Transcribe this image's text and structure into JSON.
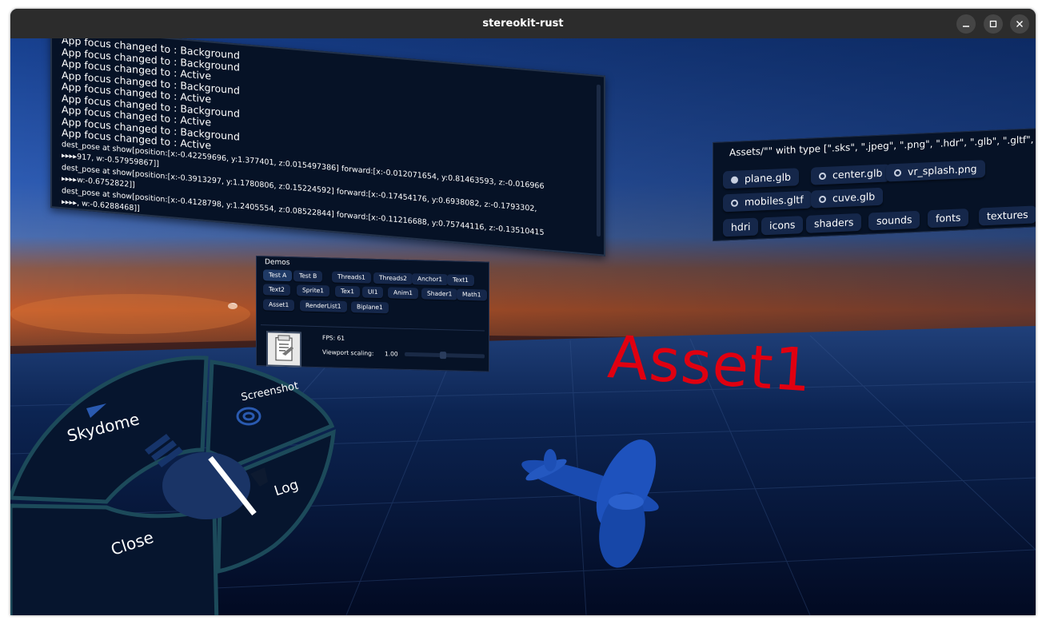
{
  "window": {
    "title": "stereokit-rust",
    "controls": [
      "minimize",
      "maximize",
      "close"
    ]
  },
  "log_panel": {
    "lines": [
      "App focus changed to : Background",
      "App focus changed to : Background",
      "App focus changed to : Active",
      "App focus changed to : Background",
      "App focus changed to : Active",
      "App focus changed to : Background",
      "App focus changed to : Active",
      "App focus changed to : Background",
      "App focus changed to : Active",
      "dest_pose at show[position:[x:-0.42259696, y:1.377401, z:0.015497386] forward:[x:-0.012071654, y:0.81463593, z:-0.016966",
      "▸▸▸▸917, w:-0.57959867]]",
      "dest_pose at show[position:[x:-0.3913297, y:1.1780806, z:0.15224592] forward:[x:-0.17454176, y:0.6938082, z:-0.1793302,",
      "▸▸▸▸w:-0.6752822]]",
      "dest_pose at show[position:[x:-0.4128798, y:1.2405554, z:0.08522844] forward:[x:-0.11216688, y:0.75744116, z:-0.13510415",
      "▸▸▸▸, w:-0.6288468]]"
    ]
  },
  "assets_panel": {
    "title": "Assets/\"\" with type [\".sks\", \".jpeg\", \".png\", \".hdr\", \".glb\", \".gltf\",",
    "files": [
      {
        "label": "plane.glb",
        "selected": true
      },
      {
        "label": "center.glb",
        "selected": false
      },
      {
        "label": "vr_splash.png",
        "selected": false
      },
      {
        "label": "mobiles.gltf",
        "selected": false
      },
      {
        "label": "cuve.glb",
        "selected": false
      }
    ],
    "folders": [
      "hdri",
      "icons",
      "shaders",
      "sounds",
      "fonts",
      "textures"
    ]
  },
  "demos_panel": {
    "title": "Demos",
    "rows": [
      [
        "Test A",
        "Test B",
        "Threads1",
        "Threads2",
        "Anchor1",
        "Text1"
      ],
      [
        "Text2",
        "Sprite1",
        "Tex1",
        "UI1",
        "Anim1",
        "Shader1",
        "Math1"
      ],
      [
        "Asset1",
        "RenderList1",
        "Biplane1"
      ]
    ],
    "fps_label": "FPS: 61",
    "viewport_label": "Viewport scaling:",
    "viewport_value": "1.00",
    "viewport_scaling": 1.0
  },
  "scene": {
    "asset_label": "Asset1",
    "asset_label_color": "#e00010",
    "model": "plane"
  },
  "radial_menu": {
    "items": [
      "Skydome",
      "Screenshot",
      "Log",
      "Close"
    ],
    "icons": [
      "skydome-icon",
      "screenshot-icon",
      "log-icon"
    ]
  },
  "colors": {
    "titlebar": "#2c2c2c",
    "panel": "#061226",
    "button": "#15274a",
    "floor": "#0a1f45",
    "accent_red": "#e00010",
    "plane_blue": "#1a4bb0"
  }
}
